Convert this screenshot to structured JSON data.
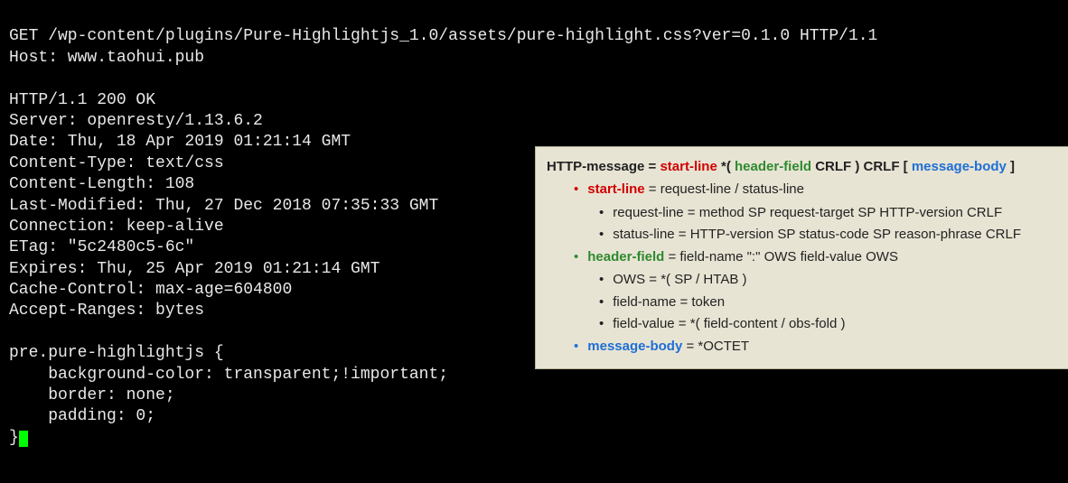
{
  "terminal": {
    "request_line": "GET /wp-content/plugins/Pure-Highlightjs_1.0/assets/pure-highlight.css?ver=0.1.0 HTTP/1.1",
    "host_line": "Host: www.taohui.pub",
    "status_line": "HTTP/1.1 200 OK",
    "server": "Server: openresty/1.13.6.2",
    "date": "Date: Thu, 18 Apr 2019 01:21:14 GMT",
    "content_type": "Content-Type: text/css",
    "content_length": "Content-Length: 108",
    "last_modified": "Last-Modified: Thu, 27 Dec 2018 07:35:33 GMT",
    "connection": "Connection: keep-alive",
    "etag": "ETag: \"5c2480c5-6c\"",
    "expires": "Expires: Thu, 25 Apr 2019 01:21:14 GMT",
    "cache_control": "Cache-Control: max-age=604800",
    "accept_ranges": "Accept-Ranges: bytes",
    "body_l1": "pre.pure-highlightjs {",
    "body_l2": "    background-color: transparent;!important;",
    "body_l3": "    border: none;",
    "body_l4": "    padding: 0;",
    "body_l5": "}"
  },
  "info": {
    "head": {
      "p1": "HTTP-message = ",
      "startline": "start-line",
      "p2": " *( ",
      "headerfield": "header-field",
      "p3": " CRLF ) CRLF [ ",
      "messagebody": "message-body",
      "p4": " ]"
    },
    "startline_def": " = request-line / status-line",
    "request_line_def": "request-line = method SP request-target SP HTTP-version CRLF",
    "status_line_def": "status-line = HTTP-version SP status-code SP reason-phrase CRLF",
    "headerfield_def": " = field-name \":\" OWS field-value OWS",
    "ows_def": "OWS = *( SP / HTAB )",
    "fieldname_def": "field-name = token",
    "fieldvalue_def": "field-value = *( field-content / obs-fold )",
    "messagebody_def": " = *OCTET",
    "labels": {
      "startline": "start-line",
      "headerfield": "header-field",
      "messagebody": "message-body"
    }
  }
}
